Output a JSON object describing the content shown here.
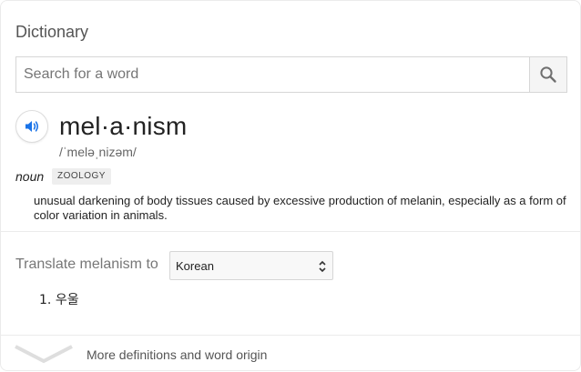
{
  "card": {
    "title": "Dictionary"
  },
  "search": {
    "placeholder": "Search for a word",
    "value": ""
  },
  "entry": {
    "headword": "mel·a·nism",
    "phonetic": "/ˈmeləˌnizəm/",
    "part_of_speech": "noun",
    "domain_badge": "ZOOLOGY",
    "definition": "unusual darkening of body tissues caused by excessive production of melanin, especially as a form of color variation in animals."
  },
  "translate": {
    "label": "Translate melanism to",
    "selected_language": "Korean",
    "results": [
      {
        "number": "1.",
        "text": "우울"
      }
    ]
  },
  "footer": {
    "more_label": "More definitions and word origin"
  },
  "colors": {
    "speaker_accent": "#1a73e8",
    "divider": "#ebebeb",
    "badge_bg": "#eeeeee"
  },
  "icons": {
    "search": "search-icon",
    "speaker": "speaker-icon",
    "select_caret": "select-caret-icon",
    "expand": "chevron-down-icon"
  }
}
